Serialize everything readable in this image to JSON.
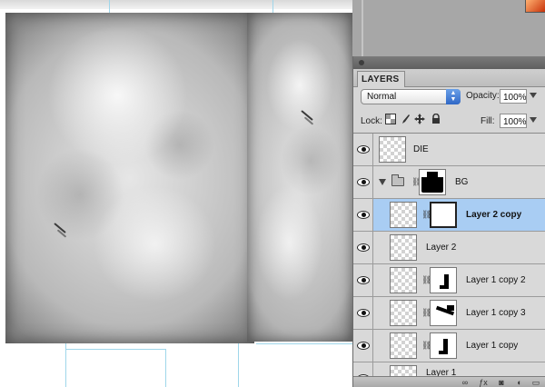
{
  "panel": {
    "tab_label": "LAYERS",
    "blend_mode": "Normal",
    "opacity_label": "Opacity:",
    "opacity_value": "100%",
    "lock_label": "Lock:",
    "fill_label": "Fill:",
    "fill_value": "100%",
    "lock_icons": [
      "lock-transparent-pixels-icon",
      "lock-image-pixels-icon",
      "lock-position-icon",
      "lock-all-icon"
    ]
  },
  "layers": [
    {
      "name": "DIE",
      "type": "layer",
      "visible": true,
      "has_mask": false,
      "selected": false
    },
    {
      "name": "BG",
      "type": "group",
      "visible": true,
      "has_mask": true,
      "expanded": true,
      "selected": false
    },
    {
      "name": "Layer 2 copy",
      "type": "layer",
      "visible": true,
      "has_mask": true,
      "selected": true
    },
    {
      "name": "Layer 2",
      "type": "layer",
      "visible": true,
      "has_mask": false,
      "selected": false
    },
    {
      "name": "Layer 1 copy 2",
      "type": "layer",
      "visible": true,
      "has_mask": true,
      "selected": false
    },
    {
      "name": "Layer 1 copy 3",
      "type": "layer",
      "visible": true,
      "has_mask": true,
      "selected": false
    },
    {
      "name": "Layer 1 copy",
      "type": "layer",
      "visible": true,
      "has_mask": true,
      "selected": false
    },
    {
      "name": "Layer 1",
      "type": "layer",
      "visible": true,
      "has_mask": false,
      "selected": false
    }
  ],
  "colors": {
    "selected_row": "#a9cdf3",
    "panel_bg": "#d6d6d6",
    "blend_arrow": "#2f67c6"
  }
}
